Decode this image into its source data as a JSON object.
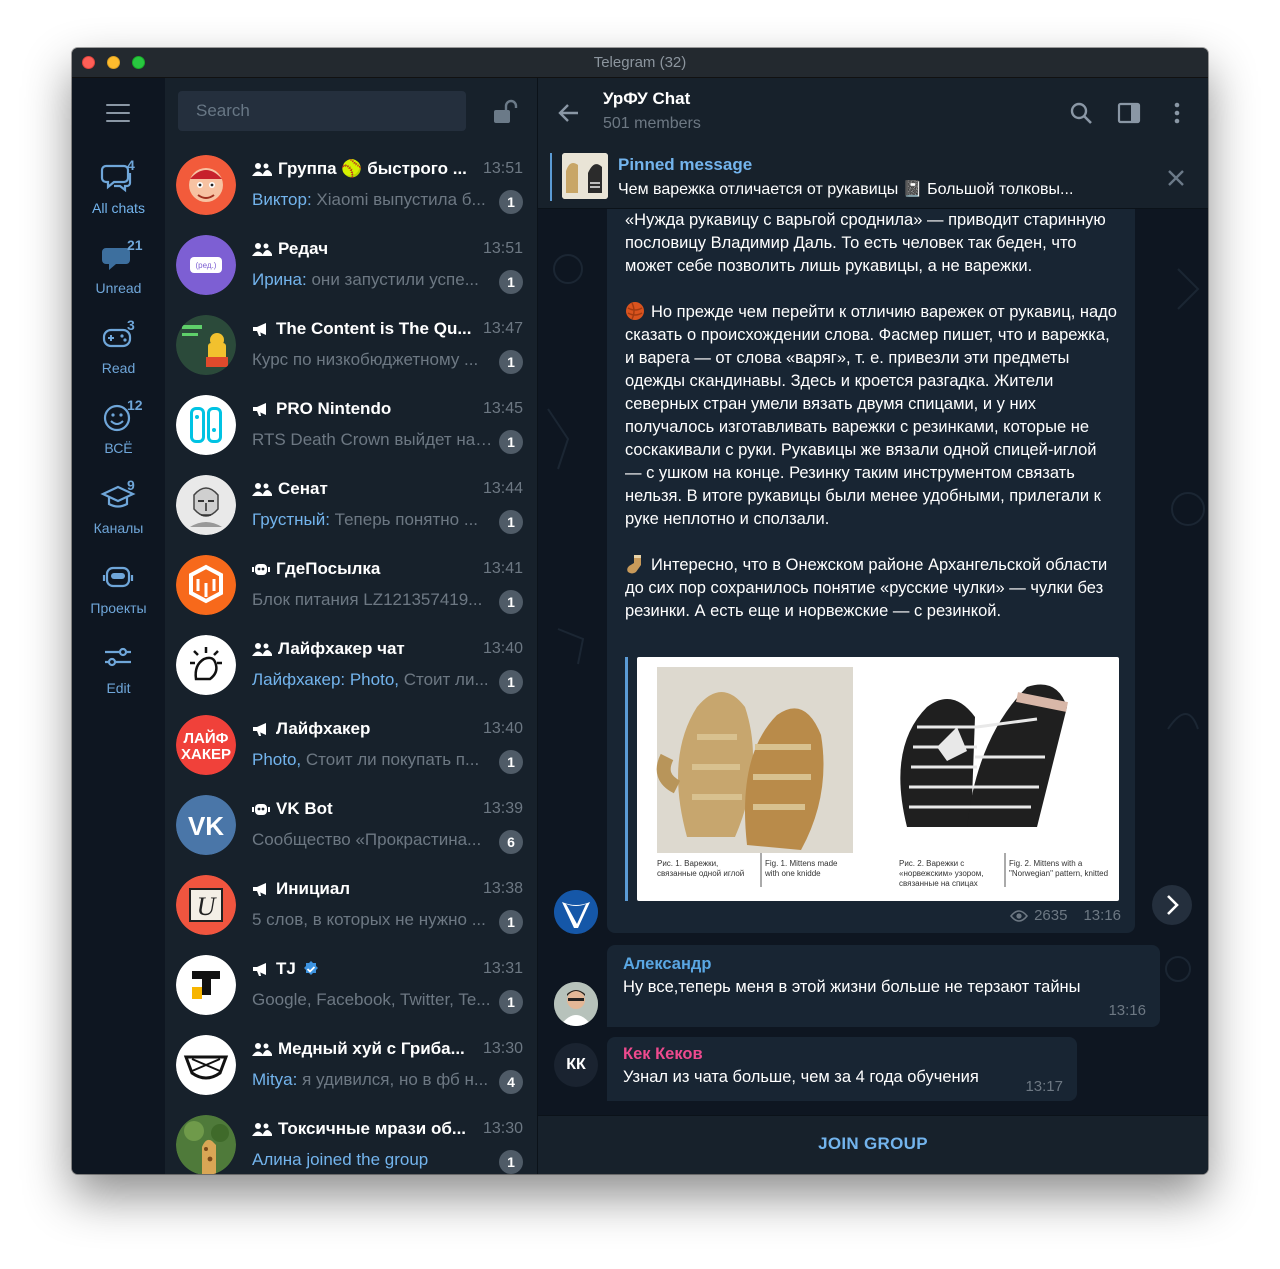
{
  "window": {
    "title": "Telegram (32)"
  },
  "search": {
    "placeholder": "Search"
  },
  "folders": [
    {
      "name": "All chats",
      "count": "4",
      "icon": "chats-icon"
    },
    {
      "name": "Unread",
      "count": "21",
      "icon": "unread-bubble-icon"
    },
    {
      "name": "Read",
      "count": "3",
      "icon": "gamepad-icon"
    },
    {
      "name": "ВСЁ",
      "count": "12",
      "icon": "emoji-face-icon"
    },
    {
      "name": "Каналы",
      "count": "9",
      "icon": "graduation-cap-icon"
    },
    {
      "name": "Проекты",
      "count": "",
      "icon": "robot-icon"
    },
    {
      "name": "Edit",
      "count": "",
      "icon": "sliders-icon"
    }
  ],
  "chats": [
    {
      "title": "Группа 🥎 быстрого ...",
      "type": "group",
      "time": "13:51",
      "sender": "Виктор:",
      "preview": " Xiaomi выпустила б...",
      "unread": "1"
    },
    {
      "title": "Редач",
      "type": "group",
      "time": "13:51",
      "sender": "Ирина:",
      "preview": " они запустили успе...",
      "unread": "1"
    },
    {
      "title": "The Content is The Qu...",
      "type": "channel",
      "time": "13:47",
      "sender": "",
      "preview": "Курс по низкобюджетному ...",
      "unread": "1"
    },
    {
      "title": "PRO Nintendo",
      "type": "channel",
      "time": "13:45",
      "sender": "",
      "preview": "RTS Death Crown выйдет на ...",
      "unread": "1"
    },
    {
      "title": "Сенат",
      "type": "group",
      "time": "13:44",
      "sender": "Грустный:",
      "preview": " Теперь понятно ...",
      "unread": "1"
    },
    {
      "title": "ГдеПосылка",
      "type": "bot",
      "time": "13:41",
      "sender": "",
      "preview": "Блок питания LZ121357419...",
      "unread": "1"
    },
    {
      "title": "Лайфхакер чат",
      "type": "group",
      "time": "13:40",
      "sender": "Лайфхакер: Photo,",
      "preview": " Стоит ли...",
      "unread": "1"
    },
    {
      "title": "Лайфхакер",
      "type": "channel",
      "time": "13:40",
      "sender": "Photo,",
      "preview": " Стоит ли покупать п...",
      "unread": "1"
    },
    {
      "title": "VK Bot",
      "type": "bot",
      "time": "13:39",
      "sender": "",
      "preview": "Сообщество «Прокрастина...",
      "unread": "6"
    },
    {
      "title": "Инициал",
      "type": "channel",
      "time": "13:38",
      "sender": "",
      "preview": "5 слов, в которых не нужно ...",
      "unread": "1"
    },
    {
      "title": "TJ",
      "type": "channel",
      "verified": true,
      "time": "13:31",
      "sender": "",
      "preview": "Google, Facebook, Twitter, Te...",
      "unread": "1"
    },
    {
      "title": "Медный хуй с Гриба...",
      "type": "group",
      "time": "13:30",
      "sender": "Mitya:",
      "preview": " я удивился, но в фб н...",
      "unread": "4"
    },
    {
      "title": "Токсичные мрази об...",
      "type": "group",
      "time": "13:30",
      "sender": "Алина joined the group",
      "preview": "",
      "unread": "1"
    }
  ],
  "chat": {
    "title": "УрФУ Chat",
    "subtitle": "501 members",
    "pinned_title": "Pinned message",
    "pinned_text": "Чем варежка отличается от рукавицы  📓 Большой толковы...",
    "join_label": "JOIN GROUP"
  },
  "messages": {
    "post": {
      "para1": "«Нужда рукавицу с варьгой сроднила» — приводит старинную пословицу Владимир Даль. То есть человек так беден, что может себе позволить лишь рукавицы, а не варежки.",
      "para2": "Но прежде чем перейти к отличию варежек от рукавиц, надо сказать о происхождении слова. Фасмер пишет, что и варежка, и варега — от слова «варяг», т. е. привезли эти предметы одежды скандинавы. Здесь и кроется разгадка. Жители северных стран умели вязать двумя спицами, и у них получалось изготавливать варежки с резинками, которые не соскакивали с руки. Рукавицы же вязали одной спицей-иглой — с ушком на конце. Резинку таким инструментом связать нельзя. В итоге рукавицы были менее удобными, прилегали к руке неплотно и сползали.",
      "para3": "Интересно, что в Онежском районе Архангельской области до сих пор сохранилось понятие «русские чулки» — чулки без резинки. А есть еще и норвежские — с резинкой.",
      "cap1_ru": "Рис. 1. Варежки, связанные одной иглой",
      "cap1_en": "Fig. 1. Mittens made with one knidde",
      "cap2_ru": "Рис. 2. Варежки с «норвежским» узором, связанные на спицах",
      "cap2_en": "Fig. 2. Mittens with a \"Norwegian\" pattern, knitted",
      "views": "2635",
      "time": "13:16"
    },
    "m1": {
      "sender": "Александр",
      "text": "Ну все,теперь меня в этой жизни больше не терзают тайны",
      "time": "13:16",
      "color": "#5aa7e3"
    },
    "m2": {
      "sender": "Кек Кеков",
      "initials": "КК",
      "text": "Узнал из чата больше, чем за 4 года обучения",
      "time": "13:17",
      "color": "#ee4a8e"
    }
  },
  "colors": {
    "accent": "#73b4ed",
    "bg": "#0e1621",
    "panel": "#17212b",
    "bubble": "#182533"
  }
}
